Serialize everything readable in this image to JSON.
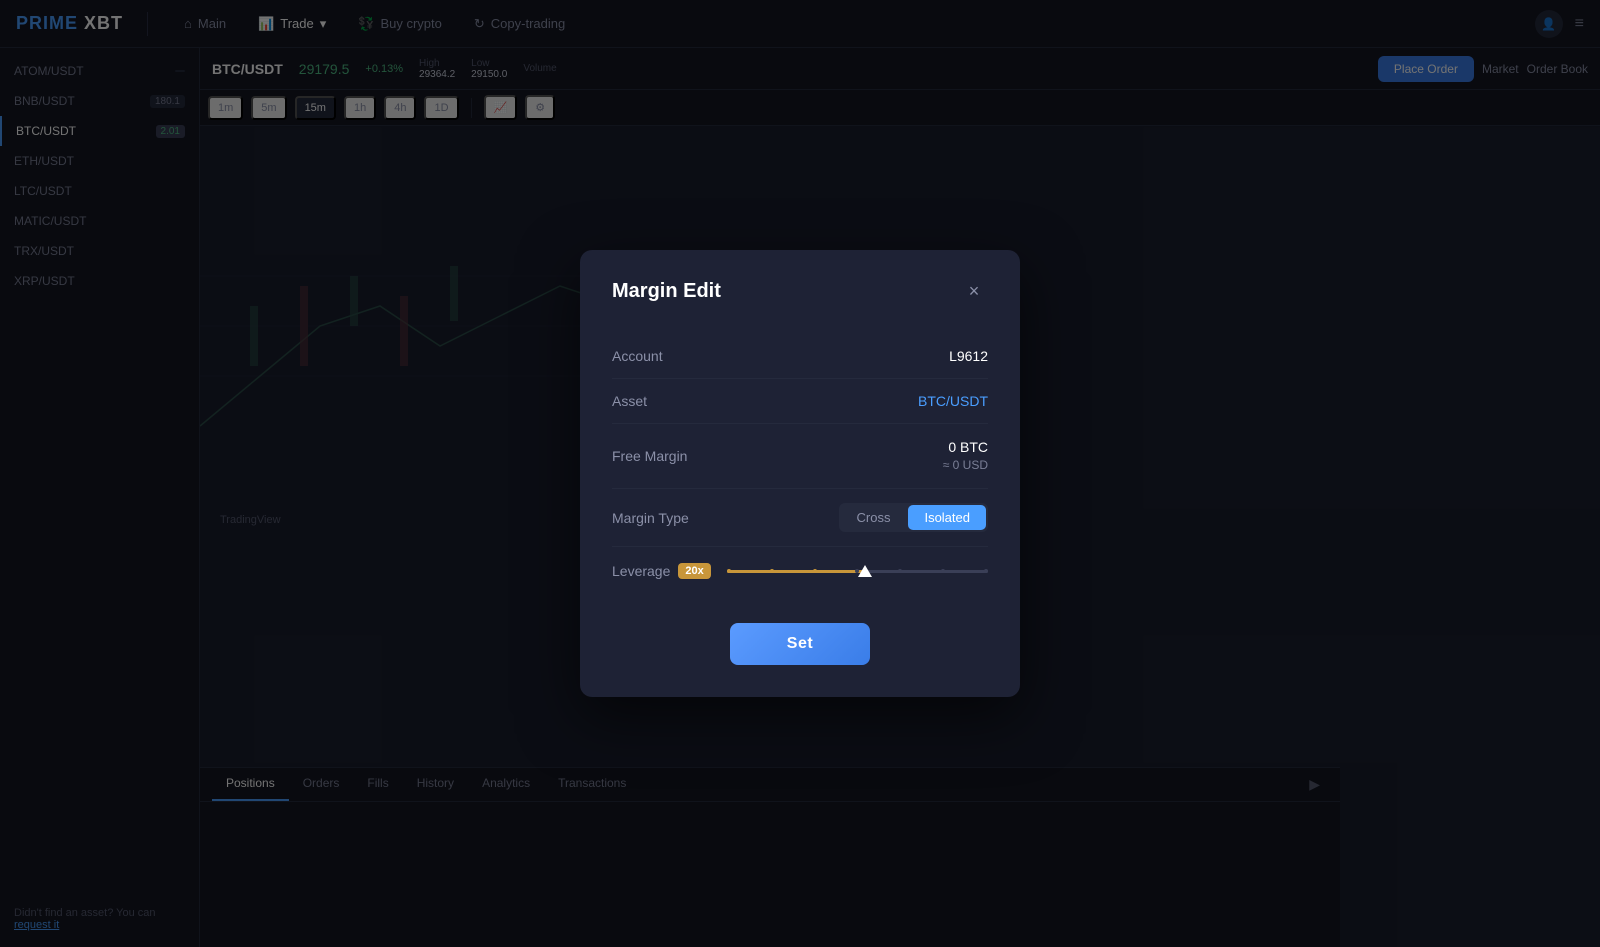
{
  "app": {
    "logo": "PRIME",
    "logo_suffix": "XBT"
  },
  "navbar": {
    "items": [
      {
        "label": "Main",
        "icon": "home-icon",
        "active": false
      },
      {
        "label": "Trade",
        "icon": "chart-icon",
        "active": true,
        "has_dropdown": true
      },
      {
        "label": "Buy crypto",
        "icon": "buy-icon",
        "active": false
      },
      {
        "label": "Copy-trading",
        "icon": "copy-icon",
        "active": false
      }
    ]
  },
  "sidebar": {
    "items": [
      {
        "label": "ATOM/USDT",
        "value": "",
        "badge": ""
      },
      {
        "label": "BNB/USDT",
        "value": "180.1",
        "badge": ""
      },
      {
        "label": "BTC/USDT",
        "value": "2.01",
        "badge": "",
        "active": true
      },
      {
        "label": "ETH/USDT",
        "value": "",
        "badge": ""
      },
      {
        "label": "LTC/USDT",
        "value": "",
        "badge": ""
      },
      {
        "label": "MATIC/USDT",
        "value": "",
        "badge": ""
      },
      {
        "label": "TRX/USDT",
        "value": "",
        "badge": ""
      },
      {
        "label": "XRP/USDT",
        "value": "",
        "badge": ""
      }
    ],
    "footer_text": "Didn't find an asset? You can",
    "footer_link": "request it"
  },
  "chart": {
    "symbol": "BTC/USDT",
    "price": "29179.5",
    "price_change": "+0.13%",
    "high_label": "High",
    "high_val": "29364.2",
    "low_label": "Low",
    "low_val": "29150.0",
    "volume_label": "Volume"
  },
  "toolbar": {
    "timeframes": [
      "1m",
      "5m",
      "15m",
      "1h",
      "4h",
      "1D"
    ],
    "active_timeframe": "15m",
    "order_btn": "Place Order",
    "market_label": "Market",
    "orderbook_label": "Order Book"
  },
  "bottom_tabs": {
    "tabs": [
      "Positions",
      "Orders",
      "Fills",
      "History",
      "Analytics",
      "Transactions"
    ]
  },
  "modal": {
    "title": "Margin Edit",
    "close_icon": "×",
    "fields": {
      "account_label": "Account",
      "account_value": "L9612",
      "asset_label": "Asset",
      "asset_value": "BTC/USDT",
      "free_margin_label": "Free Margin",
      "free_margin_btc": "0 BTC",
      "free_margin_usd": "≈ 0 USD",
      "margin_type_label": "Margin Type",
      "cross_label": "Cross",
      "isolated_label": "Isolated",
      "active_margin": "Isolated",
      "leverage_label": "Leverage",
      "leverage_value": "20x",
      "leverage_pct": 53
    },
    "set_button": "Set"
  }
}
